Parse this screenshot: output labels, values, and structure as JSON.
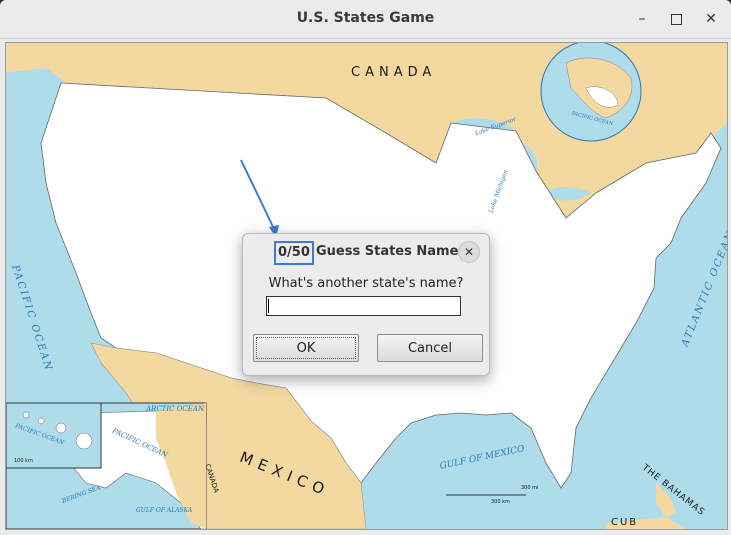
{
  "window": {
    "title": "U.S. States Game",
    "controls": [
      "minimize",
      "maximize",
      "close"
    ]
  },
  "map": {
    "labels": {
      "canada": "CANADA",
      "mexico": "MEXICO",
      "pacific_ocean_left": "PACIFIC OCEAN",
      "atlantic_ocean": "ATLANTIC OCEAN",
      "gulf_of_mexico": "GULF OF MEXICO",
      "the_bahamas": "THE BAHAMAS",
      "arctic_ocean": "ARCTIC OCEAN",
      "pacific_ocean_inset": "PACIFIC OCEAN",
      "bering_sea": "BERING SEA",
      "gulf_of_alaska": "GULF OF ALASKA",
      "canada_inset": "CANADA",
      "pacific_ocean_hawaii": "PACIFIC OCEAN",
      "globe_pacific": "PACIFIC OCEAN",
      "lake_superior": "Lake Superior",
      "lake_michigan": "Lake Michigan",
      "cuba_partial": "CUB",
      "scale_km": "100 km",
      "scale_mi": "300 mi",
      "scale_km_main": "300 km"
    },
    "colors": {
      "water": "#aedcea",
      "land_us": "#ffffff",
      "land_foreign": "#f3d8a0",
      "arrow": "#3a7bd5"
    }
  },
  "dialog": {
    "score": "0/50",
    "title": "Guess States Name",
    "prompt": "What's another state's name?",
    "answer_value": "",
    "ok_label": "OK",
    "cancel_label": "Cancel"
  }
}
